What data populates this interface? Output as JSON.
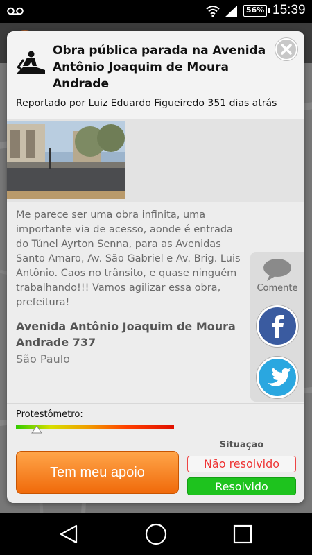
{
  "status_bar": {
    "time": "15:39",
    "battery": "56%"
  },
  "issue": {
    "title": "Obra pública parada na Avenida Antônio Joaquim de Moura Andrade",
    "reporter_line": "Reportado por Luiz Eduardo Figueiredo 351 dias atrás",
    "description": "Me parece ser uma obra infinita, uma importante via de acesso, aonde é entrada do Túnel Ayrton Senna, para as Avenidas Santo Amaro, Av. São Gabriel e Av. Brig. Luis Antônio. Caos no trânsito, e quase ninguém trabalhando!!! Vamos agilizar essa obra, prefeitura!",
    "address": "Avenida Antônio Joaquim de Moura Andrade 737",
    "city": "São Paulo"
  },
  "share": {
    "comment_label": "Comente"
  },
  "protest_meter": {
    "label": "Protestômetro:",
    "level_fraction": 0.13
  },
  "actions": {
    "support_label": "Tem meu apoio",
    "situation_label": "Situação",
    "unresolved_label": "Não resolvido",
    "resolved_label": "Resolvido"
  },
  "colors": {
    "support_button": "#f07d1e",
    "resolved": "#1ec31e",
    "unresolved": "#e33333",
    "facebook": "#3a5ba0",
    "twitter": "#2aa7e0"
  },
  "icons": [
    "voicemail-icon",
    "wifi-icon",
    "signal-icon",
    "battery-icon",
    "worker-icon",
    "close-icon",
    "comment-icon",
    "facebook-icon",
    "twitter-icon",
    "back-icon",
    "home-icon",
    "recents-icon"
  ]
}
